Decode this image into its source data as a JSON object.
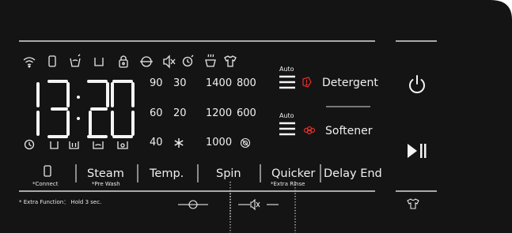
{
  "display": {
    "time": "13:20",
    "wifi_icon": "wifi-icon",
    "phone_icon": "phone-icon",
    "status_icons": [
      "wifi-icon",
      "phone-icon",
      "pre-wash-icon",
      "wash-icon",
      "child-lock-icon",
      "spin-icon",
      "mute-icon",
      "delay-icon",
      "steam-icon",
      "shirt-icon"
    ],
    "stage_icons": [
      "clock-icon",
      "wash-stage-icon",
      "rinse-stage-icon",
      "rinse-extra-icon",
      "drain-icon"
    ]
  },
  "temperature": {
    "options": [
      "90",
      "30",
      "60",
      "20",
      "40"
    ],
    "cold_icon": "snowflake-icon"
  },
  "spin": {
    "options": [
      "1400",
      "800",
      "1200",
      "600",
      "1000"
    ],
    "no_spin_icon": "no-spin-icon"
  },
  "detergent": {
    "auto_label": "Auto",
    "label": "Detergent",
    "icon": "detergent-warning-icon"
  },
  "softener": {
    "auto_label": "Auto",
    "label": "Softener",
    "icon": "flower-icon"
  },
  "buttons": {
    "connect": {
      "sub": "*Connect"
    },
    "steam": {
      "label": "Steam",
      "sub": "*Pre Wash"
    },
    "temp": {
      "label": "Temp."
    },
    "spin": {
      "label": "Spin"
    },
    "quicker": {
      "label": "Quicker",
      "sub": "*Extra Rinse"
    },
    "delay_end": {
      "label": "Delay End"
    }
  },
  "footer": {
    "note": "* Extra Function： Hold 3 sec."
  },
  "colors": {
    "panel": "#141414",
    "text": "#f0f0f0",
    "accent_red": "#e0302c",
    "page": "#ffffff"
  }
}
